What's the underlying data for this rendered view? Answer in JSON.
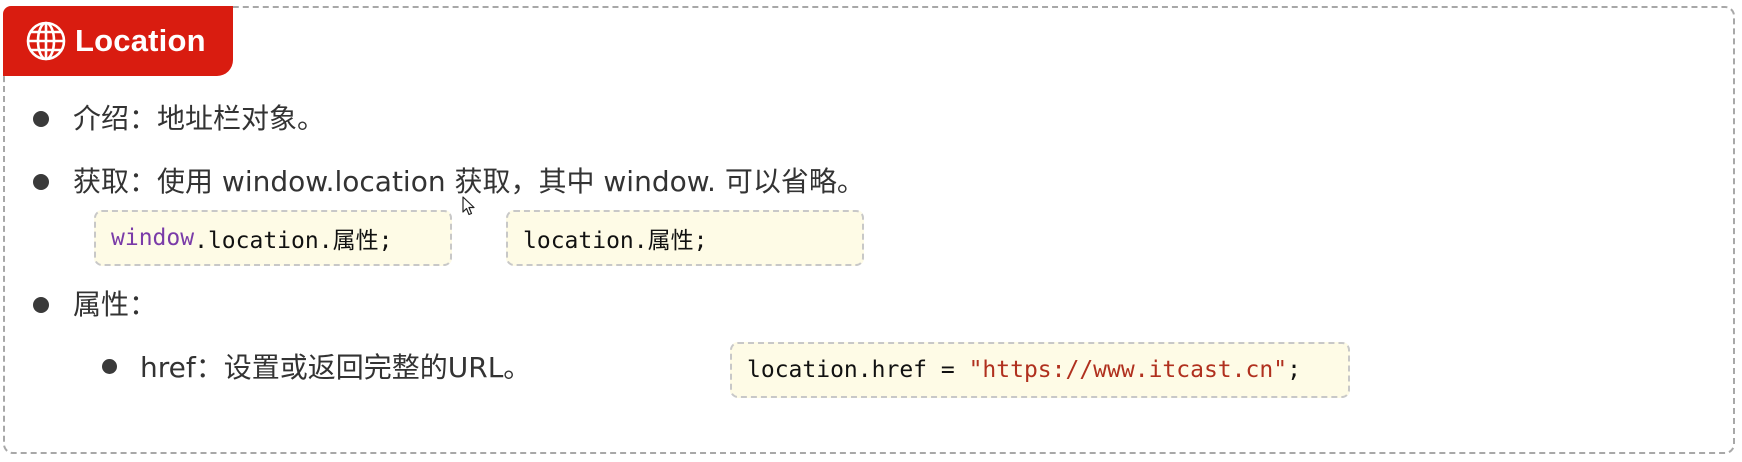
{
  "header": {
    "title": "Location",
    "icon": "globe-icon",
    "accent_color": "#d91c10"
  },
  "items": [
    {
      "label": "介绍",
      "separator": "：",
      "text": "地址栏对象。"
    },
    {
      "label": "获取",
      "separator": "：",
      "text": "使用 window.location 获取，其中 window. 可以省略。",
      "code_examples": [
        {
          "keyword": "window",
          "rest": ".location.属性;"
        },
        {
          "plain": "location.属性;"
        }
      ]
    },
    {
      "label": "属性",
      "separator": "：",
      "sub_items": [
        {
          "label": "href",
          "separator": "：",
          "text": "设置或返回完整的URL。",
          "code": {
            "prefix": "location.href = ",
            "string": "\"https://www.itcast.cn\"",
            "suffix": ";"
          }
        }
      ]
    }
  ]
}
